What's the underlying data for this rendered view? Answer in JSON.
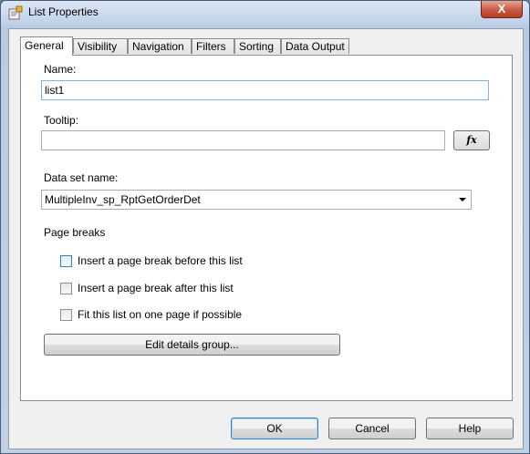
{
  "window": {
    "title": "List Properties",
    "close_glyph": "X"
  },
  "tabs": [
    {
      "label": "General",
      "active": true
    },
    {
      "label": "Visibility",
      "active": false
    },
    {
      "label": "Navigation",
      "active": false
    },
    {
      "label": "Filters",
      "active": false
    },
    {
      "label": "Sorting",
      "active": false
    },
    {
      "label": "Data Output",
      "active": false
    }
  ],
  "general": {
    "name_label": "Name:",
    "name_value": "list1",
    "tooltip_label": "Tooltip:",
    "tooltip_value": "",
    "fx_label": "fx",
    "dataset_label": "Data set name:",
    "dataset_value": "MultipleInv_sp_RptGetOrderDet",
    "page_breaks_label": "Page breaks",
    "checkboxes": [
      {
        "label": "Insert a page break before this list",
        "checked": false
      },
      {
        "label": "Insert a page break after this list",
        "checked": false
      },
      {
        "label": "Fit this list on one page if possible",
        "checked": false
      }
    ],
    "edit_details_label": "Edit details group..."
  },
  "footer": {
    "ok_label": "OK",
    "cancel_label": "Cancel",
    "help_label": "Help"
  },
  "colors": {
    "accent": "#3c7fb1",
    "focus_border": "#7eb4ea",
    "close_red": "#c75a42"
  },
  "icons": {
    "title_icon": "properties-icon",
    "combo_arrow": "chevron-down-icon"
  }
}
